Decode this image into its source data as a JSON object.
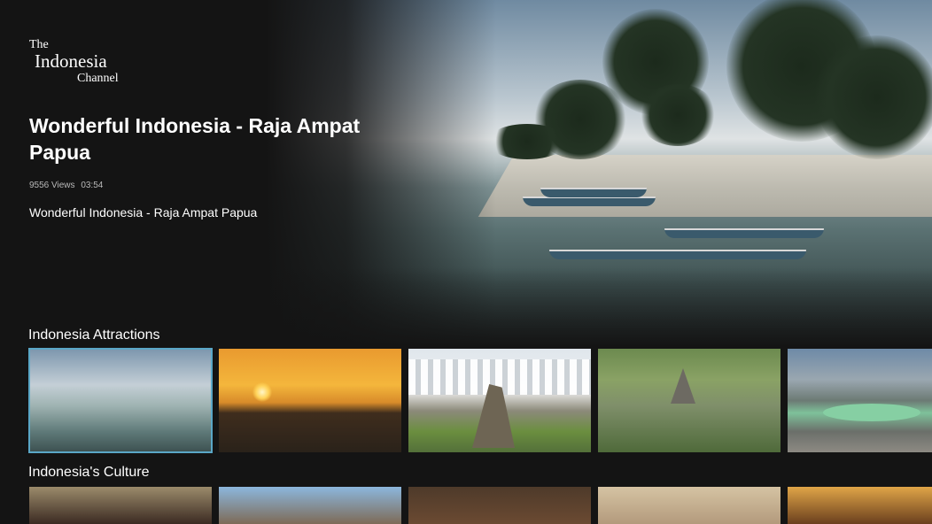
{
  "app": {
    "logo": {
      "line1": "The",
      "line2": "Indonesia",
      "line3": "Channel"
    }
  },
  "featured": {
    "title": "Wonderful Indonesia - Raja Ampat Papua",
    "views": "9556 Views",
    "duration": "03:54",
    "description": "Wonderful Indonesia - Raja Ampat Papua"
  },
  "rows": [
    {
      "title": "Indonesia Attractions",
      "items": [
        {
          "thumb": "beach-boats"
        },
        {
          "thumb": "sunset-lake"
        },
        {
          "thumb": "museum-courtyard-statue"
        },
        {
          "thumb": "temple-complex-aerial"
        },
        {
          "thumb": "volcano-crater-lake"
        }
      ]
    },
    {
      "title": "Indonesia's Culture",
      "items": [
        {
          "thumb": "traditional-dancers"
        },
        {
          "thumb": "cultural-ornament"
        },
        {
          "thumb": "ceremony-performers"
        },
        {
          "thumb": "man-portrait"
        },
        {
          "thumb": "stage-performance"
        }
      ]
    }
  ],
  "colors": {
    "background": "#141414",
    "focus_outline": "#5aa7c7",
    "meta_text": "#b9b9b9"
  }
}
